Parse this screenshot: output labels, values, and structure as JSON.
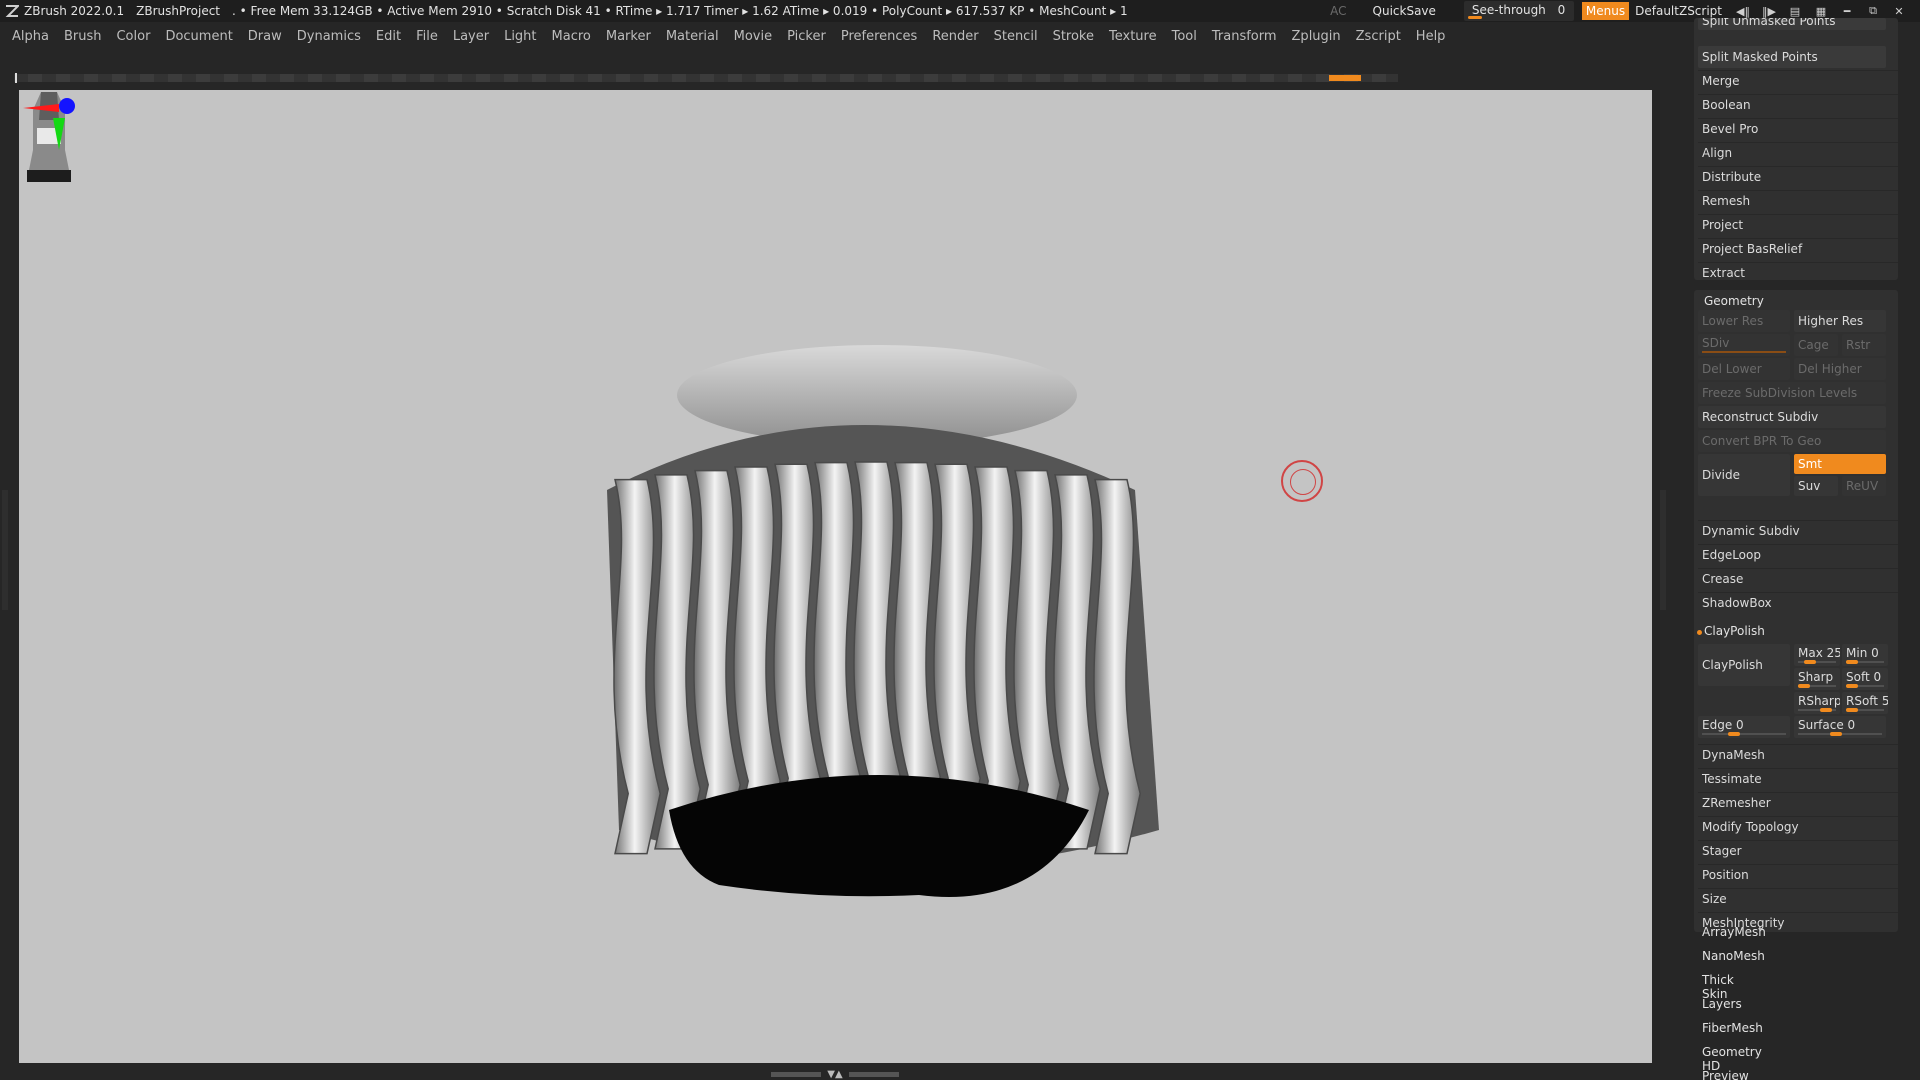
{
  "titlebar": {
    "app": "ZBrush 2022.0.1",
    "project": "ZBrushProject",
    "stats": ". • Free Mem 33.124GB • Active Mem 2910 • Scratch Disk 41 • RTime ▸ 1.717 Timer ▸ 1.62 ATime ▸ 0.019 • PolyCount ▸ 617.537 KP • MeshCount ▸ 1",
    "ac": "AC",
    "quicksave": "QuickSave",
    "see_through": "See-through",
    "see_through_value": "0",
    "menus": "Menus",
    "default_zscript": "DefaultZScript"
  },
  "menubar": [
    "Alpha",
    "Brush",
    "Color",
    "Document",
    "Draw",
    "Dynamics",
    "Edit",
    "File",
    "Layer",
    "Light",
    "Macro",
    "Marker",
    "Material",
    "Movie",
    "Picker",
    "Preferences",
    "Render",
    "Stencil",
    "Stroke",
    "Texture",
    "Tool",
    "Transform",
    "Zplugin",
    "Zscript",
    "Help"
  ],
  "panel": {
    "top_items": [
      "Split Unmasked Points",
      "Split Masked Points",
      "Merge",
      "Boolean",
      "Bevel Pro",
      "Align",
      "Distribute",
      "Remesh",
      "Project",
      "Project BasRelief",
      "Extract"
    ],
    "geometry": {
      "title": "Geometry",
      "lower_res": "Lower Res",
      "higher_res": "Higher Res",
      "sdiv": "SDiv",
      "cage": "Cage",
      "rstr": "Rstr",
      "del_lower": "Del Lower",
      "del_higher": "Del Higher",
      "freeze": "Freeze SubDivision Levels",
      "reconstruct": "Reconstruct Subdiv",
      "convert_bpr": "Convert BPR To Geo",
      "divide": "Divide",
      "smt": "Smt",
      "suv": "Suv",
      "reuv": "ReUV",
      "items_a": [
        "Dynamic Subdiv",
        "EdgeLoop",
        "Crease",
        "ShadowBox"
      ],
      "claypolish_title": "ClayPolish",
      "claypolish_btn": "ClayPolish",
      "max": "Max 25",
      "min": "Min 0",
      "sharp": "Sharp",
      "soft": "Soft 0",
      "rsharp": "RSharp",
      "rsoft": "RSoft 5",
      "edge": "Edge 0",
      "surface": "Surface 0",
      "items_b": [
        "DynaMesh",
        "Tessimate",
        "ZRemesher",
        "Modify Topology",
        "Stager",
        "Position",
        "Size",
        "MeshIntegrity"
      ]
    },
    "bottom_items": [
      "ArrayMesh",
      "NanoMesh",
      "Thick Skin",
      "Layers",
      "FiberMesh",
      "Geometry HD",
      "Preview"
    ]
  },
  "colors": {
    "accent": "#f08a1e",
    "canvas": "#c4c4c4",
    "ui_bg": "#262626"
  }
}
